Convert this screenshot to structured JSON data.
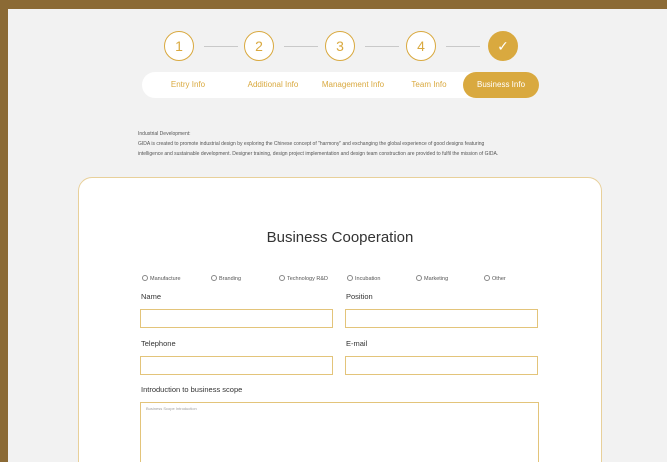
{
  "stepper": {
    "steps": [
      "1",
      "2",
      "3",
      "4",
      "✓"
    ],
    "accent": "#d9a93f"
  },
  "tabs": [
    "Entry Info",
    "Additional Info",
    "Management Info",
    "Team Info",
    "Business Info"
  ],
  "active_tab": "Business Info",
  "description": {
    "heading": "Industrial Development:",
    "line1": "GIDA is created to promote industrial design by exploring the Chinese concept of \"harmony\" and exchanging the global experience of good designs featuring",
    "line2": "intelligence and sustainable development. Designer training, design project implementation and design team construction are provided to fulfil the mission of GIDA."
  },
  "form": {
    "title": "Business Cooperation",
    "options": [
      "Manufacture",
      "Branding",
      "Technology R&D",
      "Incubation",
      "Marketing",
      "Other"
    ],
    "name_label": "Name",
    "position_label": "Position",
    "telephone_label": "Telephone",
    "email_label": "E-mail",
    "intro_label": "Introduction to business scope",
    "intro_placeholder": "Business Scope Introduction"
  }
}
